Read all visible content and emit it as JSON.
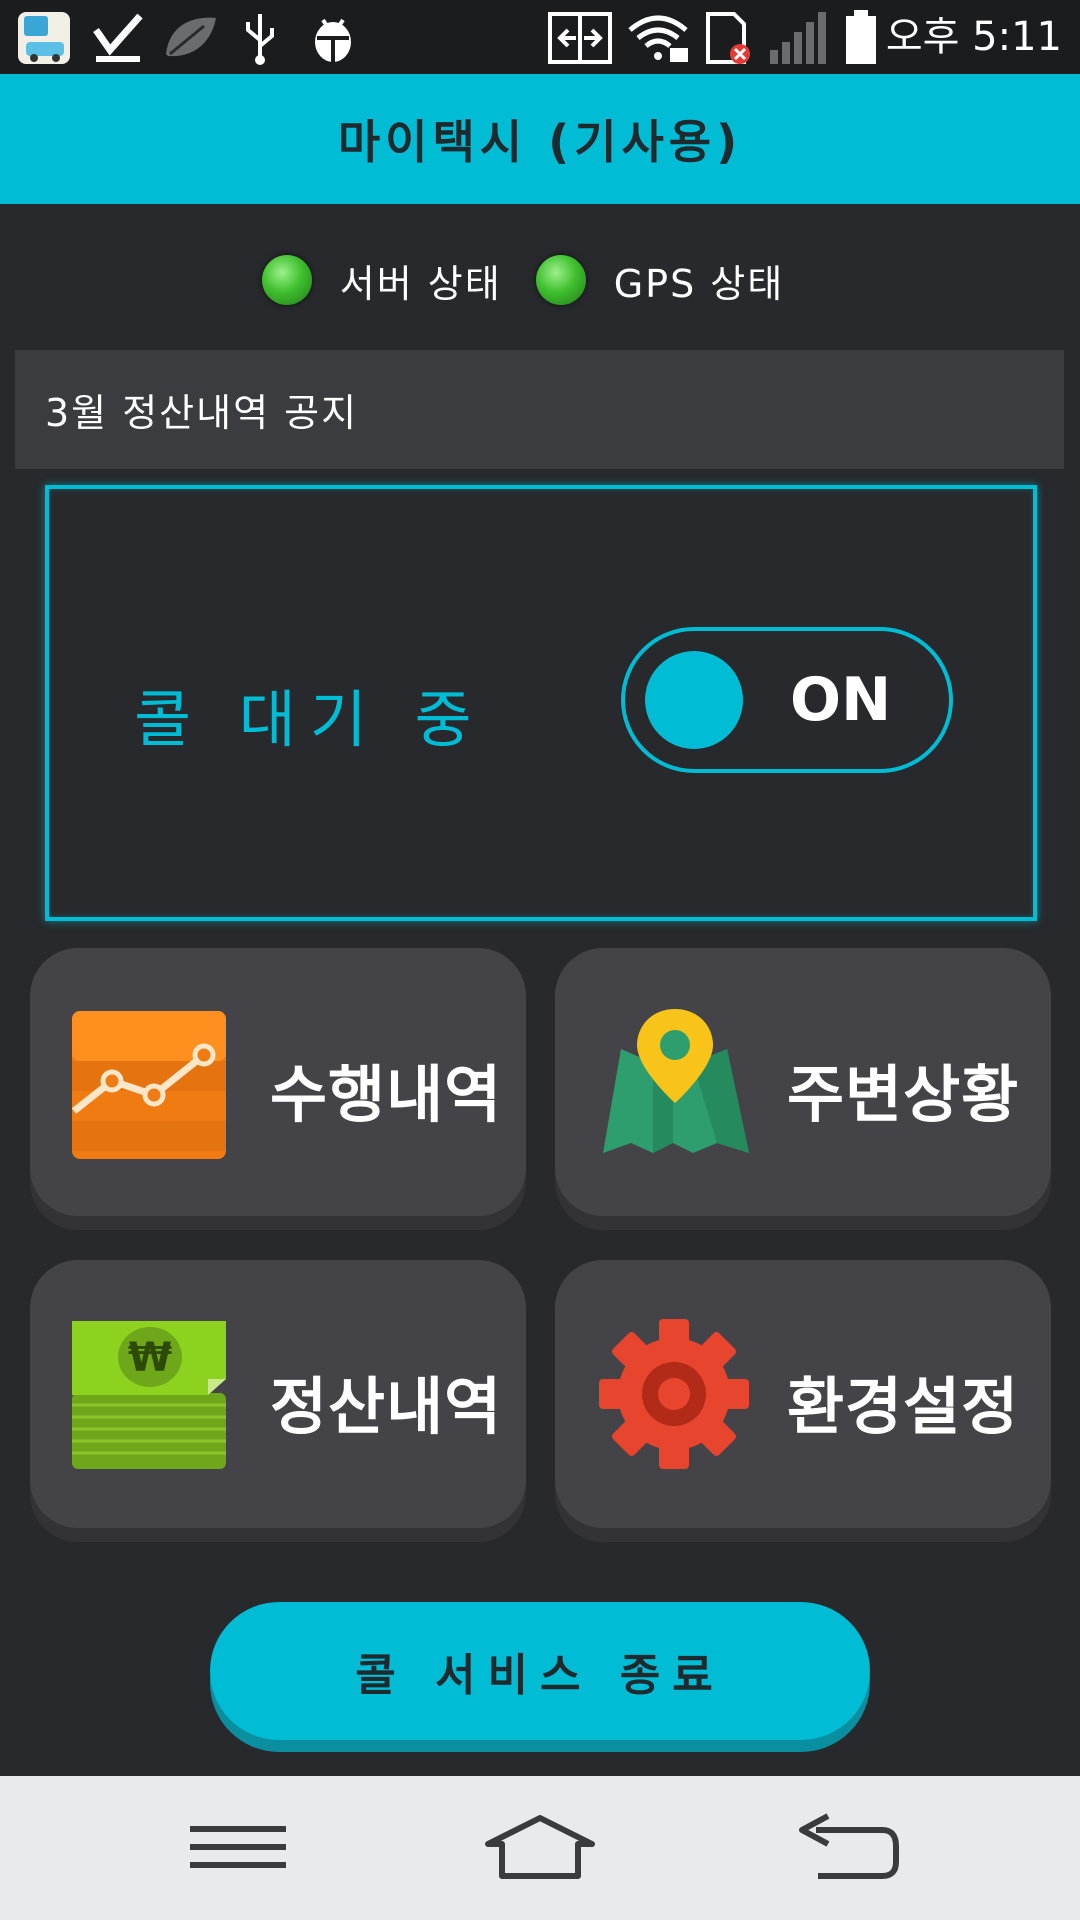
{
  "status_bar": {
    "time": "오후 5:11",
    "icons": [
      "mytaxi-app-icon",
      "download-done-icon",
      "leaf-icon",
      "usb-icon",
      "debug-bug-icon",
      "screen-mirror-icon",
      "wifi-lock-icon",
      "sim-error-icon",
      "signal-icon",
      "battery-icon"
    ]
  },
  "app": {
    "title": "마이택시 (기사용)"
  },
  "status_indicators": {
    "server_label": "서버 상태",
    "gps_label": "GPS 상태",
    "server_color": "#3fbf2e",
    "gps_color": "#3fbf2e"
  },
  "notice": {
    "text": "3월 정산내역 공지"
  },
  "call": {
    "status_text": "콜 대기 중",
    "toggle_label": "ON",
    "toggle_on": true
  },
  "menu": {
    "history": {
      "label": "수행내역",
      "icon": "chart-icon"
    },
    "nearby": {
      "label": "주변상황",
      "icon": "map-pin-icon"
    },
    "settlement": {
      "label": "정산내역",
      "icon": "money-icon"
    },
    "settings": {
      "label": "환경설정",
      "icon": "gear-icon"
    }
  },
  "end_button": {
    "label": "콜 서비스 종료"
  },
  "colors": {
    "accent": "#00bcd4",
    "background": "#27292c",
    "tile": "#434348"
  }
}
